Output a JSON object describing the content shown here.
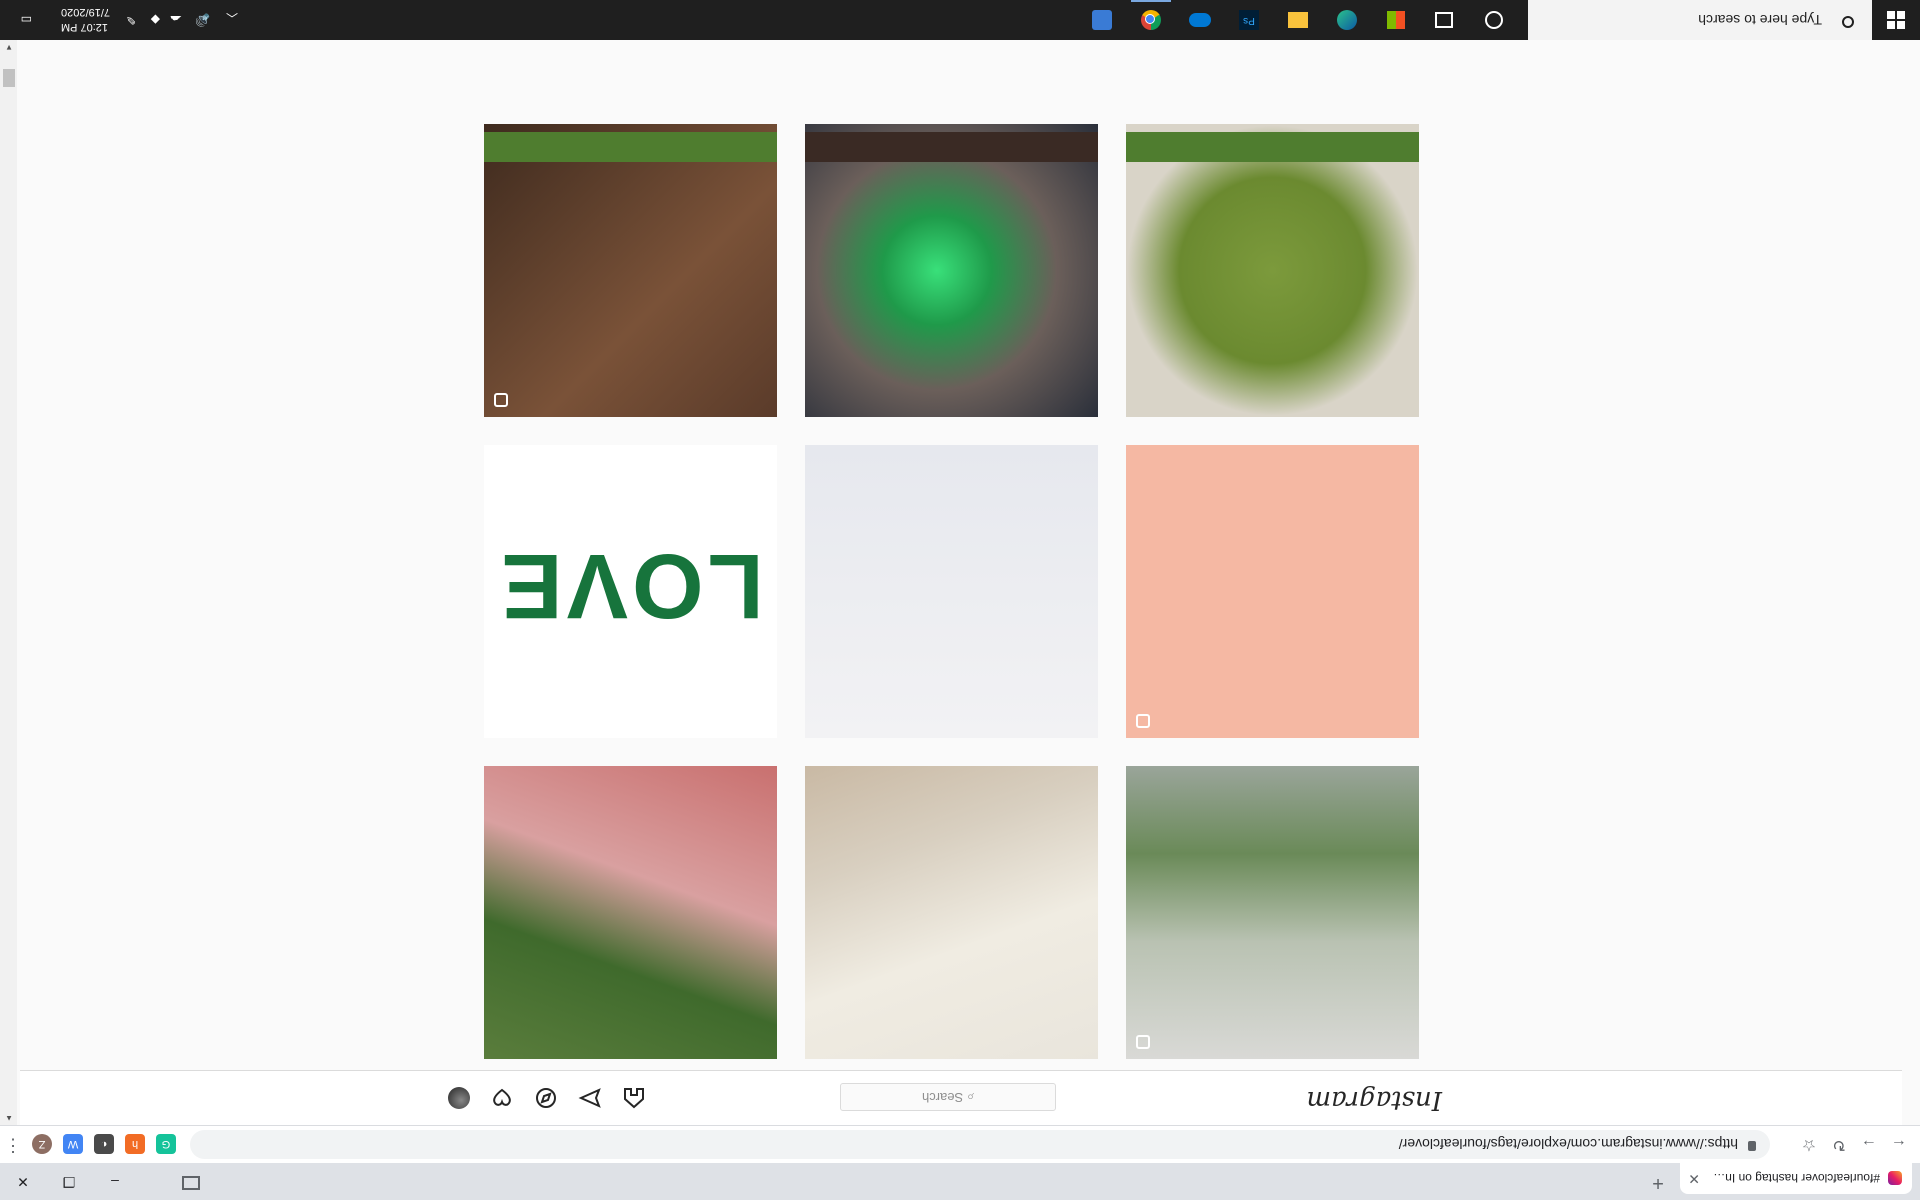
{
  "browser": {
    "tab_title": "#fourleafclover hashtag on Insta",
    "new_tab": "+",
    "url": "https://www.instagram.com/explore/tags/fourleafclover/",
    "window_controls": {
      "minimize": "–",
      "maximize": "❐",
      "close": "✕"
    },
    "extensions": [
      {
        "icon": "grammarly-icon",
        "color": "#15c39a",
        "label": "G"
      },
      {
        "icon": "honey-icon",
        "color": "#f26c25",
        "label": "h"
      },
      {
        "icon": "dark-mode-icon",
        "color": "#4a4a4a",
        "label": "◐"
      },
      {
        "icon": "wappalyzer-icon",
        "color": "#4285f4",
        "label": "W"
      },
      {
        "icon": "ublock-icon",
        "color": "#1b5e20",
        "label": "$"
      },
      {
        "icon": "puzzle-icon",
        "color": "#5f6368",
        "label": "✚"
      },
      {
        "icon": "profile-avatar",
        "color": "#8d6e63",
        "label": "Z"
      }
    ]
  },
  "instagram": {
    "logo": "Instagram",
    "search_placeholder": "Search",
    "nav_icons": [
      "home-icon",
      "direct-icon",
      "explore-icon",
      "activity-icon",
      "profile-avatar"
    ]
  },
  "grid": {
    "rows": [
      [
        {
          "name": "photo-clover-in-glass-vase",
          "multi": true,
          "bg": "linear-gradient(180deg,#d9d9d6 0%,#b9c2b2 40%,#6a8a58 70%,#9aa59a 100%)",
          "icon": "multiple-images-icon"
        },
        {
          "name": "photo-hand-holding-clover-on-cloth",
          "multi": false,
          "bg": "linear-gradient(160deg,#e9e5dc 0%,#f0ece2 40%,#d8cfc0 70%,#c9b9a4 100%)"
        },
        {
          "name": "photo-fingers-holding-clover",
          "multi": false,
          "bg": "linear-gradient(200deg,#5a7d3c 0%,#3f6a2c 35%,#d9a0a0 60%,#c9706f 100%)"
        }
      ],
      [
        {
          "name": "photo-clover-earrings-on-peach",
          "multi": true,
          "bg": "#f5b8a3",
          "icon": "multiple-images-icon"
        },
        {
          "name": "photo-beaded-bracelets",
          "multi": false,
          "bg": "linear-gradient(180deg,#f2f2f4 0%,#e6e8ee 100%)"
        },
        {
          "name": "photo-love-clover-graphic",
          "multi": false,
          "bg": "#ffffff",
          "text": "LOVE"
        }
      ],
      [
        {
          "name": "photo-crochet-clover",
          "multi": false,
          "bg": "radial-gradient(circle at 50% 50%,#7c9a3c 0%,#6b8a30 45%,#d9d4c8 70%)"
        },
        {
          "name": "photo-painted-clover-outline",
          "multi": false,
          "bg": "radial-gradient(circle at 55% 50%,#39e07a 0%,#1f9a4a 25%,#6b5f5a 55%,#2a2f3a 100%)"
        },
        {
          "name": "photo-clover-tray-and-coasters",
          "multi": true,
          "bg": "linear-gradient(135deg,#5a3b2a 0%,#7a5238 40%,#3e2a1e 100%)",
          "icon": "multiple-images-icon"
        }
      ]
    ]
  },
  "taskbar": {
    "search_placeholder": "Type here to search",
    "time": "12:07 PM",
    "date": "7/19/2020",
    "apps": [
      "cortana-icon",
      "task-view-icon",
      "store-icon",
      "edge-icon",
      "file-explorer-icon",
      "photoshop-icon",
      "onedrive-icon",
      "chrome-icon",
      "settings-icon"
    ],
    "tray": [
      "chevron-up-icon",
      "volume-icon",
      "onedrive-tray-icon",
      "dropbox-icon",
      "pen-icon",
      "notification-icon"
    ]
  }
}
